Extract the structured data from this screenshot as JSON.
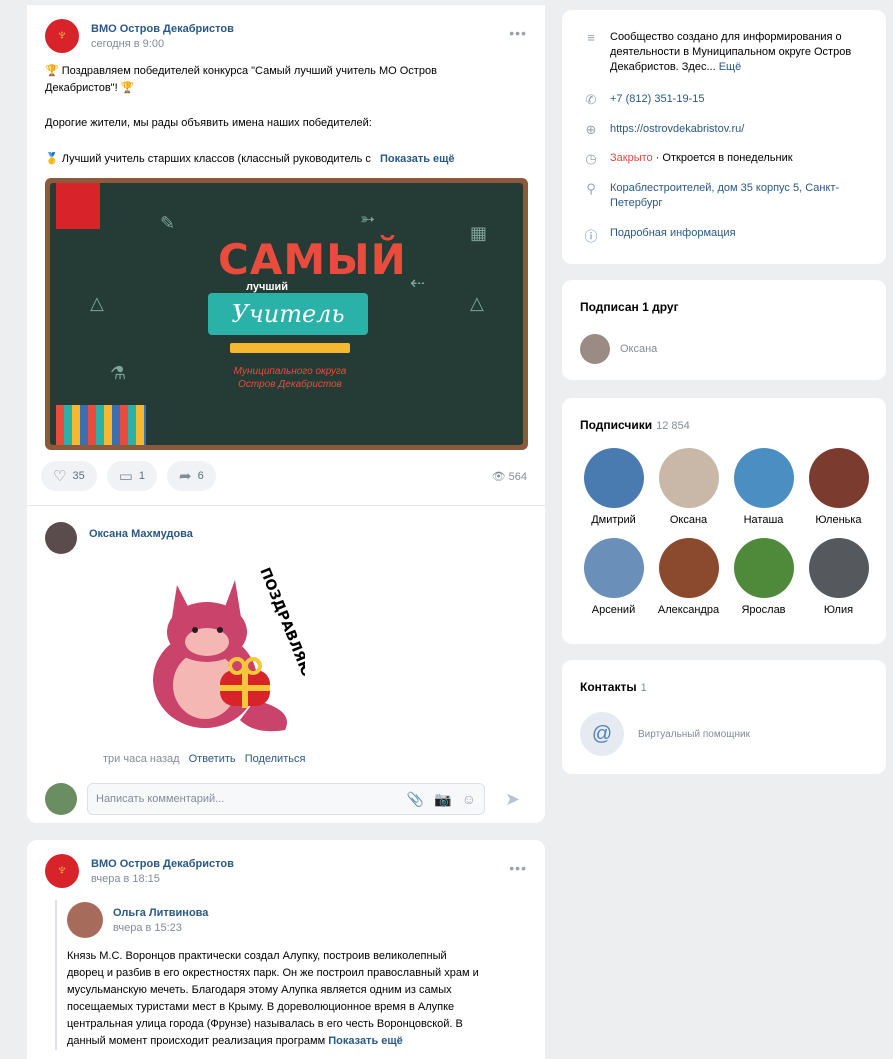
{
  "post1": {
    "author": "ВМО Остров Декабристов",
    "time": "сегодня в 9:00",
    "line1": "🏆 Поздравляем победителей конкурса \"Самый лучший учитель МО Остров",
    "line2": "Декабристов\"! 🏆",
    "line3": "Дорогие жители, мы рады объявить имена наших победителей:",
    "line4": "🥇 Лучший учитель старших классов (классный руководитель с",
    "show_more": "Показать ещё",
    "image": {
      "title_top": "САМЫЙ",
      "title_mid": "лучший",
      "title_banner": "Учитель",
      "subtitle_1": "Муниципального округа",
      "subtitle_2": "Остров Декабристов"
    },
    "likes": "35",
    "comments": "1",
    "shares": "6",
    "views": "564",
    "comment": {
      "author": "Оксана Махмудова",
      "sticker_text": "ПОЗДРАВЛЯЮ",
      "time": "три часа назад",
      "reply": "Ответить",
      "share": "Поделиться"
    },
    "reply_placeholder": "Написать комментарий..."
  },
  "post2": {
    "author": "ВМО Остров Декабристов",
    "time": "вчера в 18:15",
    "repost_author": "Ольга Литвинова",
    "repost_time": "вчера в 15:23",
    "text_lines": [
      "Князь М.С. Воронцов практически создал Алупку, построив великолепный",
      "дворец и разбив в его окрестностях парк. Он же построил православный храм и",
      "мусульманскую мечеть. Благодаря этому Алупка является одним из самых",
      "посещаемых туристами мест в Крыму. В дореволюционное время в Алупке",
      "центральная улица города (Фрунзе) называлась в его честь Воронцовской. В",
      "данный момент происходит реализация программ"
    ],
    "show_more": "Показать ещё"
  },
  "info": {
    "description": "Сообщество создано для информирования о деятельности в Муниципальном округе Остров Декабристов. Здес...",
    "more": "Ещё",
    "phone": "+7 (812) 351-19-15",
    "site": "https://ostrovdekabristov.ru/",
    "closed": "Закрыто",
    "opens": "· Откроется в понедельник",
    "address": "Кораблестроителей, дом 35 корпус 5, Санкт-Петербург",
    "details": "Подробная информация"
  },
  "friends": {
    "title": "Подписан 1 друг",
    "name": "Оксана"
  },
  "subscribers": {
    "title": "Подписчики",
    "count": "12 854",
    "people": [
      {
        "name": "Дмитрий",
        "color": "#4a7bb0"
      },
      {
        "name": "Оксана",
        "color": "#c9b8a8"
      },
      {
        "name": "Наташа",
        "color": "#4b8fc2"
      },
      {
        "name": "Юленька",
        "color": "#7b3b2f"
      },
      {
        "name": "Арсений",
        "color": "#6a8fb8"
      },
      {
        "name": "Александра",
        "color": "#8b4a2e"
      },
      {
        "name": "Ярослав",
        "color": "#4f8a3a"
      },
      {
        "name": "Юлия",
        "color": "#55595e"
      }
    ]
  },
  "contacts": {
    "title": "Контакты",
    "count": "1",
    "name": "Виртуальный помощник"
  }
}
